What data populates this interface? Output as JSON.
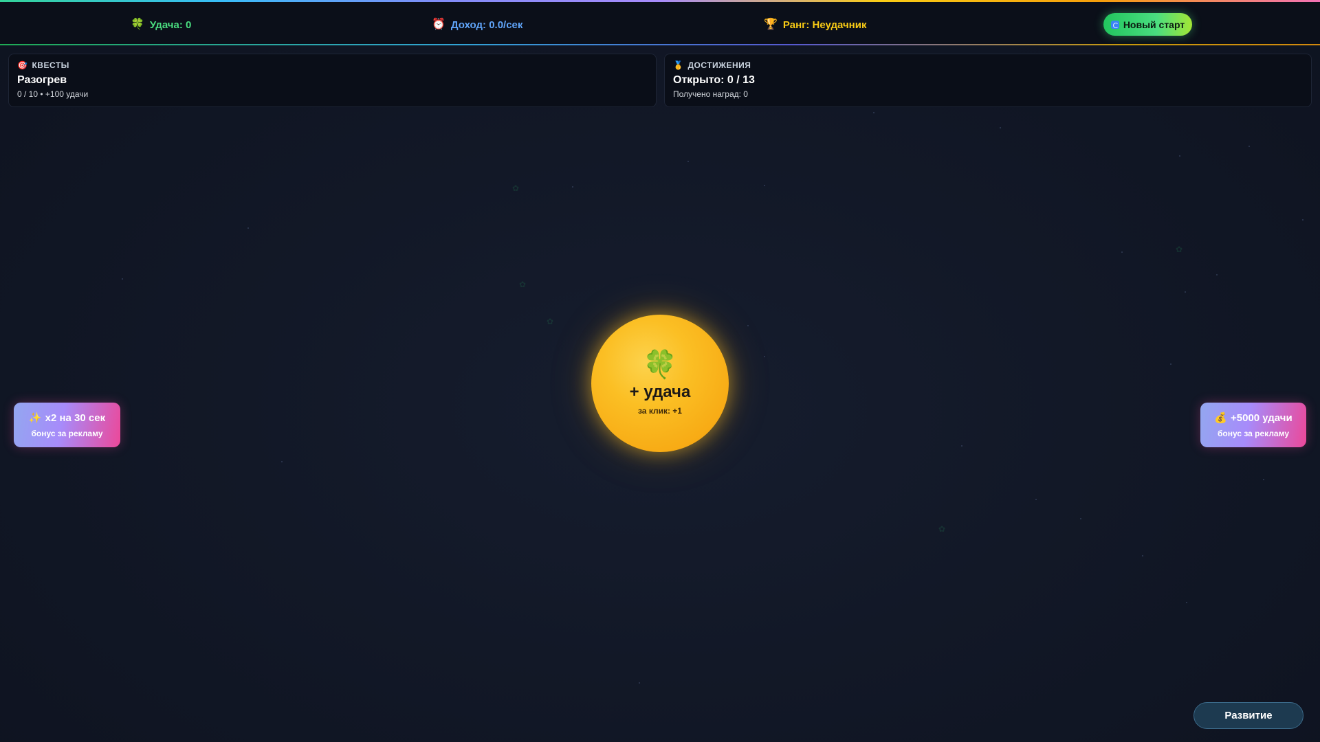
{
  "header": {
    "luck": {
      "icon": "clover-icon",
      "glyph": "🍀",
      "label": "Удача: 0"
    },
    "income": {
      "icon": "alarm-clock-icon",
      "glyph": "⏰",
      "label": "Доход: 0.0/сек"
    },
    "rank": {
      "icon": "trophy-icon",
      "glyph": "🏆",
      "label": "Ранг: Неудачник"
    },
    "new_start_label": "Новый старт"
  },
  "quests": {
    "icon": "target-icon",
    "glyph": "🎯",
    "heading": "КВЕСТЫ",
    "title": "Разогрев",
    "progress": "0 / 10 • +100 удачи"
  },
  "achievements": {
    "icon": "medal-icon",
    "glyph": "🥇",
    "heading": "ДОСТИЖЕНИЯ",
    "title": "Открыто: 0 / 13",
    "rewards": "Получено наград: 0"
  },
  "main_button": {
    "glyph": "🍀",
    "label": "+ удача",
    "per_click": "за клик: +1"
  },
  "bonus_left": {
    "icon": "sparkles-icon",
    "glyph": "✨",
    "title": "x2 на 30 сек",
    "subtitle": "бонус за рекламу"
  },
  "bonus_right": {
    "icon": "money-bag-icon",
    "glyph": "💰",
    "title": "+5000 удачи",
    "subtitle": "бонус за рекламу"
  },
  "dev_button_label": "Развитие",
  "colors": {
    "luck": "#4ade80",
    "income": "#60a5fa",
    "rank": "#facc15",
    "accent_gold": "#fbbf24",
    "bonus_gradient_start": "#93a7f0",
    "bonus_gradient_end": "#ec4899"
  }
}
